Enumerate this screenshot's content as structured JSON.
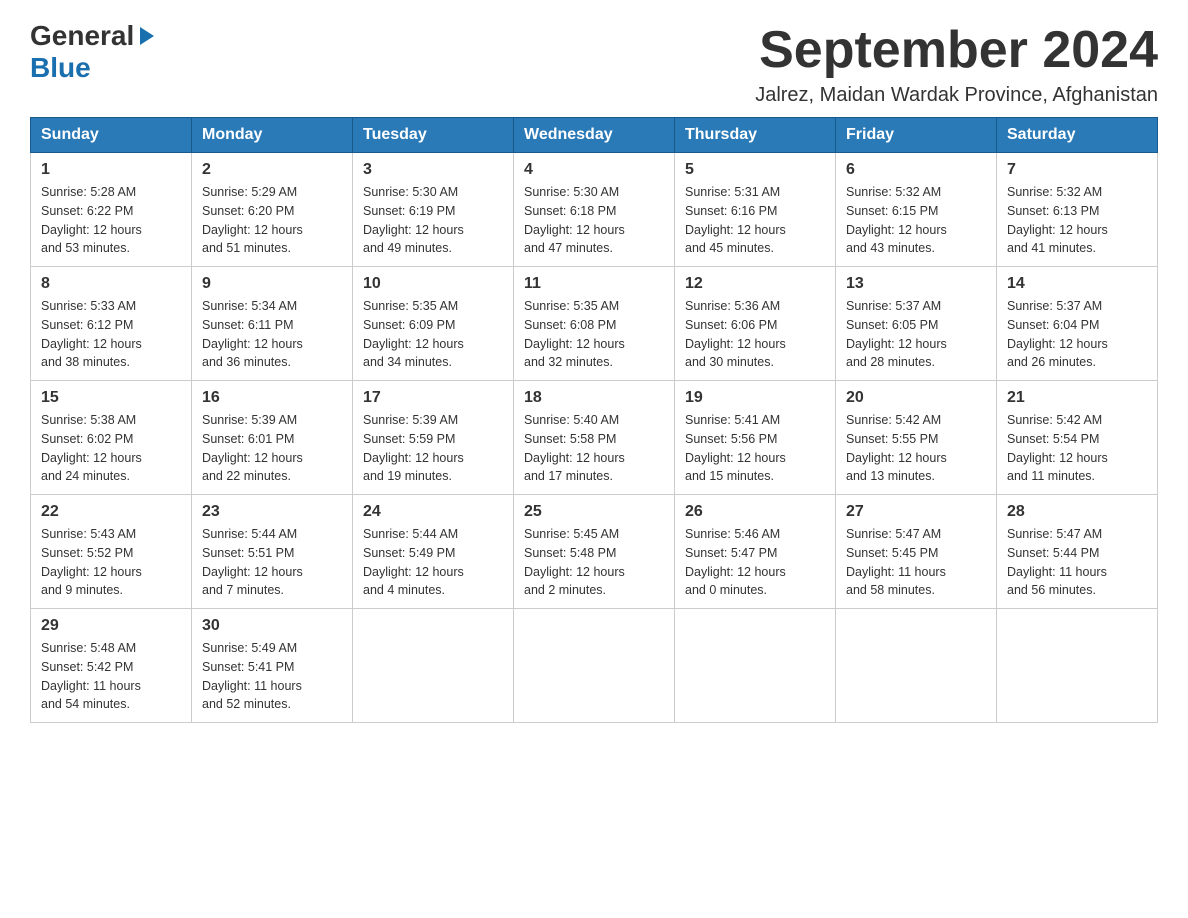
{
  "header": {
    "logo_general": "General",
    "logo_blue": "Blue",
    "month_title": "September 2024",
    "location": "Jalrez, Maidan Wardak Province, Afghanistan"
  },
  "weekdays": [
    "Sunday",
    "Monday",
    "Tuesday",
    "Wednesday",
    "Thursday",
    "Friday",
    "Saturday"
  ],
  "weeks": [
    [
      {
        "day": "1",
        "sunrise": "5:28 AM",
        "sunset": "6:22 PM",
        "daylight": "12 hours and 53 minutes."
      },
      {
        "day": "2",
        "sunrise": "5:29 AM",
        "sunset": "6:20 PM",
        "daylight": "12 hours and 51 minutes."
      },
      {
        "day": "3",
        "sunrise": "5:30 AM",
        "sunset": "6:19 PM",
        "daylight": "12 hours and 49 minutes."
      },
      {
        "day": "4",
        "sunrise": "5:30 AM",
        "sunset": "6:18 PM",
        "daylight": "12 hours and 47 minutes."
      },
      {
        "day": "5",
        "sunrise": "5:31 AM",
        "sunset": "6:16 PM",
        "daylight": "12 hours and 45 minutes."
      },
      {
        "day": "6",
        "sunrise": "5:32 AM",
        "sunset": "6:15 PM",
        "daylight": "12 hours and 43 minutes."
      },
      {
        "day": "7",
        "sunrise": "5:32 AM",
        "sunset": "6:13 PM",
        "daylight": "12 hours and 41 minutes."
      }
    ],
    [
      {
        "day": "8",
        "sunrise": "5:33 AM",
        "sunset": "6:12 PM",
        "daylight": "12 hours and 38 minutes."
      },
      {
        "day": "9",
        "sunrise": "5:34 AM",
        "sunset": "6:11 PM",
        "daylight": "12 hours and 36 minutes."
      },
      {
        "day": "10",
        "sunrise": "5:35 AM",
        "sunset": "6:09 PM",
        "daylight": "12 hours and 34 minutes."
      },
      {
        "day": "11",
        "sunrise": "5:35 AM",
        "sunset": "6:08 PM",
        "daylight": "12 hours and 32 minutes."
      },
      {
        "day": "12",
        "sunrise": "5:36 AM",
        "sunset": "6:06 PM",
        "daylight": "12 hours and 30 minutes."
      },
      {
        "day": "13",
        "sunrise": "5:37 AM",
        "sunset": "6:05 PM",
        "daylight": "12 hours and 28 minutes."
      },
      {
        "day": "14",
        "sunrise": "5:37 AM",
        "sunset": "6:04 PM",
        "daylight": "12 hours and 26 minutes."
      }
    ],
    [
      {
        "day": "15",
        "sunrise": "5:38 AM",
        "sunset": "6:02 PM",
        "daylight": "12 hours and 24 minutes."
      },
      {
        "day": "16",
        "sunrise": "5:39 AM",
        "sunset": "6:01 PM",
        "daylight": "12 hours and 22 minutes."
      },
      {
        "day": "17",
        "sunrise": "5:39 AM",
        "sunset": "5:59 PM",
        "daylight": "12 hours and 19 minutes."
      },
      {
        "day": "18",
        "sunrise": "5:40 AM",
        "sunset": "5:58 PM",
        "daylight": "12 hours and 17 minutes."
      },
      {
        "day": "19",
        "sunrise": "5:41 AM",
        "sunset": "5:56 PM",
        "daylight": "12 hours and 15 minutes."
      },
      {
        "day": "20",
        "sunrise": "5:42 AM",
        "sunset": "5:55 PM",
        "daylight": "12 hours and 13 minutes."
      },
      {
        "day": "21",
        "sunrise": "5:42 AM",
        "sunset": "5:54 PM",
        "daylight": "12 hours and 11 minutes."
      }
    ],
    [
      {
        "day": "22",
        "sunrise": "5:43 AM",
        "sunset": "5:52 PM",
        "daylight": "12 hours and 9 minutes."
      },
      {
        "day": "23",
        "sunrise": "5:44 AM",
        "sunset": "5:51 PM",
        "daylight": "12 hours and 7 minutes."
      },
      {
        "day": "24",
        "sunrise": "5:44 AM",
        "sunset": "5:49 PM",
        "daylight": "12 hours and 4 minutes."
      },
      {
        "day": "25",
        "sunrise": "5:45 AM",
        "sunset": "5:48 PM",
        "daylight": "12 hours and 2 minutes."
      },
      {
        "day": "26",
        "sunrise": "5:46 AM",
        "sunset": "5:47 PM",
        "daylight": "12 hours and 0 minutes."
      },
      {
        "day": "27",
        "sunrise": "5:47 AM",
        "sunset": "5:45 PM",
        "daylight": "11 hours and 58 minutes."
      },
      {
        "day": "28",
        "sunrise": "5:47 AM",
        "sunset": "5:44 PM",
        "daylight": "11 hours and 56 minutes."
      }
    ],
    [
      {
        "day": "29",
        "sunrise": "5:48 AM",
        "sunset": "5:42 PM",
        "daylight": "11 hours and 54 minutes."
      },
      {
        "day": "30",
        "sunrise": "5:49 AM",
        "sunset": "5:41 PM",
        "daylight": "11 hours and 52 minutes."
      },
      null,
      null,
      null,
      null,
      null
    ]
  ],
  "labels": {
    "sunrise": "Sunrise:",
    "sunset": "Sunset:",
    "daylight": "Daylight:"
  }
}
